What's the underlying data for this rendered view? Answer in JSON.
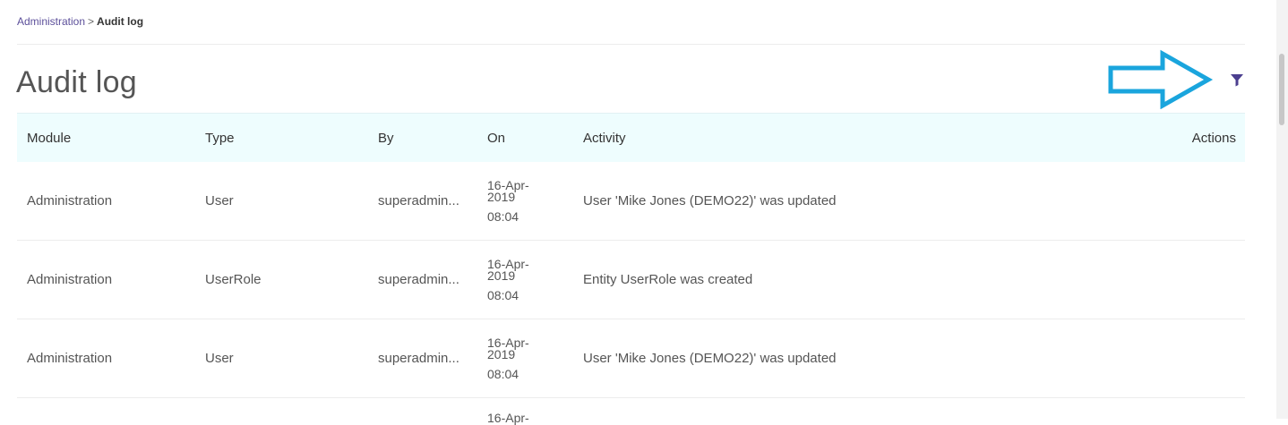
{
  "breadcrumb": {
    "parent": "Administration",
    "separator": ">",
    "current": "Audit log"
  },
  "page": {
    "title": "Audit log"
  },
  "filter": {
    "icon": "filter-icon",
    "color": "#4b3f8f"
  },
  "annotation": {
    "arrow_color": "#1aa5dd"
  },
  "table": {
    "headers": {
      "module": "Module",
      "type": "Type",
      "by": "By",
      "on": "On",
      "activity": "Activity",
      "actions": "Actions"
    },
    "rows": [
      {
        "module": "Administration",
        "type": "User",
        "by": "superadmin...",
        "on_date_1": "16-Apr-",
        "on_date_2": "2019",
        "on_time": "08:04",
        "activity": "User 'Mike Jones (DEMO22)' was updated"
      },
      {
        "module": "Administration",
        "type": "UserRole",
        "by": "superadmin...",
        "on_date_1": "16-Apr-",
        "on_date_2": "2019",
        "on_time": "08:04",
        "activity": "Entity UserRole was created"
      },
      {
        "module": "Administration",
        "type": "User",
        "by": "superadmin...",
        "on_date_1": "16-Apr-",
        "on_date_2": "2019",
        "on_time": "08:04",
        "activity": "User 'Mike Jones (DEMO22)' was updated"
      }
    ],
    "partial_row": {
      "on_date_1": "16-Apr-"
    }
  }
}
